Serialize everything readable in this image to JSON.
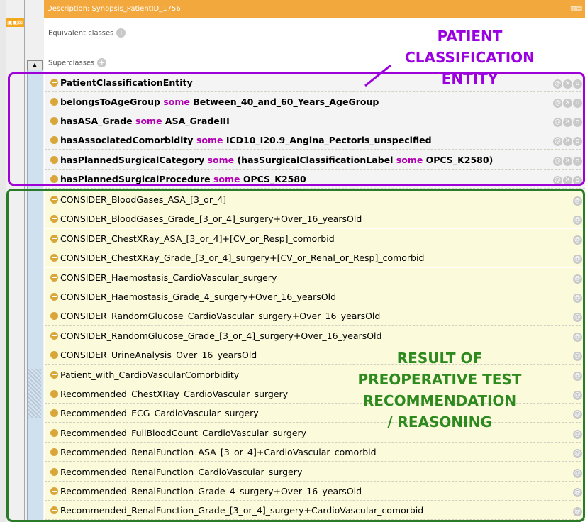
{
  "left_panel": {
    "window_icons": "▣▣⊠",
    "scroll_up": "▲"
  },
  "header": {
    "title": "Description: Synopsis_PatientID_1756",
    "icons": "▥▤"
  },
  "equivalent_classes": {
    "label": "Equivalent classes",
    "add_icon": "+"
  },
  "superclasses": {
    "label": "Superclasses",
    "add_icon": "+",
    "items": [
      {
        "parts": [
          {
            "t": "PatientClassificationEntity",
            "k": false
          }
        ]
      },
      {
        "parts": [
          {
            "t": "belongsToAgeGroup ",
            "k": false
          },
          {
            "t": "some",
            "k": true
          },
          {
            "t": " Between_40_and_60_Years_AgeGroup",
            "k": false
          }
        ]
      },
      {
        "parts": [
          {
            "t": "hasASA_Grade ",
            "k": false
          },
          {
            "t": "some",
            "k": true
          },
          {
            "t": " ASA_GradeIII",
            "k": false
          }
        ]
      },
      {
        "parts": [
          {
            "t": "hasAssociatedComorbidity ",
            "k": false
          },
          {
            "t": "some",
            "k": true
          },
          {
            "t": " ICD10_I20.9_Angina_Pectoris_unspecified",
            "k": false
          }
        ]
      },
      {
        "parts": [
          {
            "t": "hasPlannedSurgicalCategory ",
            "k": false
          },
          {
            "t": "some",
            "k": true
          },
          {
            "t": " (hasSurgicalClassificationLabel ",
            "k": false
          },
          {
            "t": "some",
            "k": true
          },
          {
            "t": " OPCS_K2580)",
            "k": false
          }
        ]
      },
      {
        "parts": [
          {
            "t": "hasPlannedSurgicalProcedure ",
            "k": false
          },
          {
            "t": "some",
            "k": true
          },
          {
            "t": " OPCS_K2580",
            "k": false
          }
        ]
      }
    ],
    "row_icons": [
      "@",
      "✕",
      "o"
    ]
  },
  "inferred": {
    "items": [
      "CONSIDER_BloodGases_ASA_[3_or_4]",
      "CONSIDER_BloodGases_Grade_[3_or_4]_surgery+Over_16_yearsOld",
      "CONSIDER_ChestXRay_ASA_[3_or_4]+[CV_or_Resp]_comorbid",
      "CONSIDER_ChestXRay_Grade_[3_or_4]_surgery+[CV_or_Renal_or_Resp]_comorbid",
      "CONSIDER_Haemostasis_CardioVascular_surgery",
      "CONSIDER_Haemostasis_Grade_4_surgery+Over_16_yearsOld",
      "CONSIDER_RandomGlucose_CardioVascular_surgery+Over_16_yearsOld",
      "CONSIDER_RandomGlucose_Grade_[3_or_4]_surgery+Over_16_yearsOld",
      "CONSIDER_UrineAnalysis_Over_16_yearsOld",
      "Patient_with_CardioVascularComorbidity",
      "Recommended_ChestXRay_CardioVascular_surgery",
      "Recommended_ECG_CardioVascular_surgery",
      "Recommended_FullBloodCount_CardioVascular_surgery",
      "Recommended_RenalFunction_ASA_[3_or_4]+CardioVascular_comorbid",
      "Recommended_RenalFunction_CardioVascular_surgery",
      "Recommended_RenalFunction_Grade_4_surgery+Over_16_yearsOld",
      "Recommended_RenalFunction_Grade_[3_or_4]_surgery+CardioVascular_comorbid"
    ],
    "row_icon": "@"
  },
  "annotations": {
    "patient": [
      "PATIENT",
      "CLASSIFICATION",
      "ENTITY"
    ],
    "result": [
      "RESULT OF",
      "PREOPERATIVE TEST",
      "RECOMMENDATION",
      "/ REASONING"
    ]
  },
  "colors": {
    "keyword": "#b000b0",
    "title_bar": "#f2a83c",
    "patient_box": "#a000d8",
    "result_box": "#2a7a2a"
  }
}
